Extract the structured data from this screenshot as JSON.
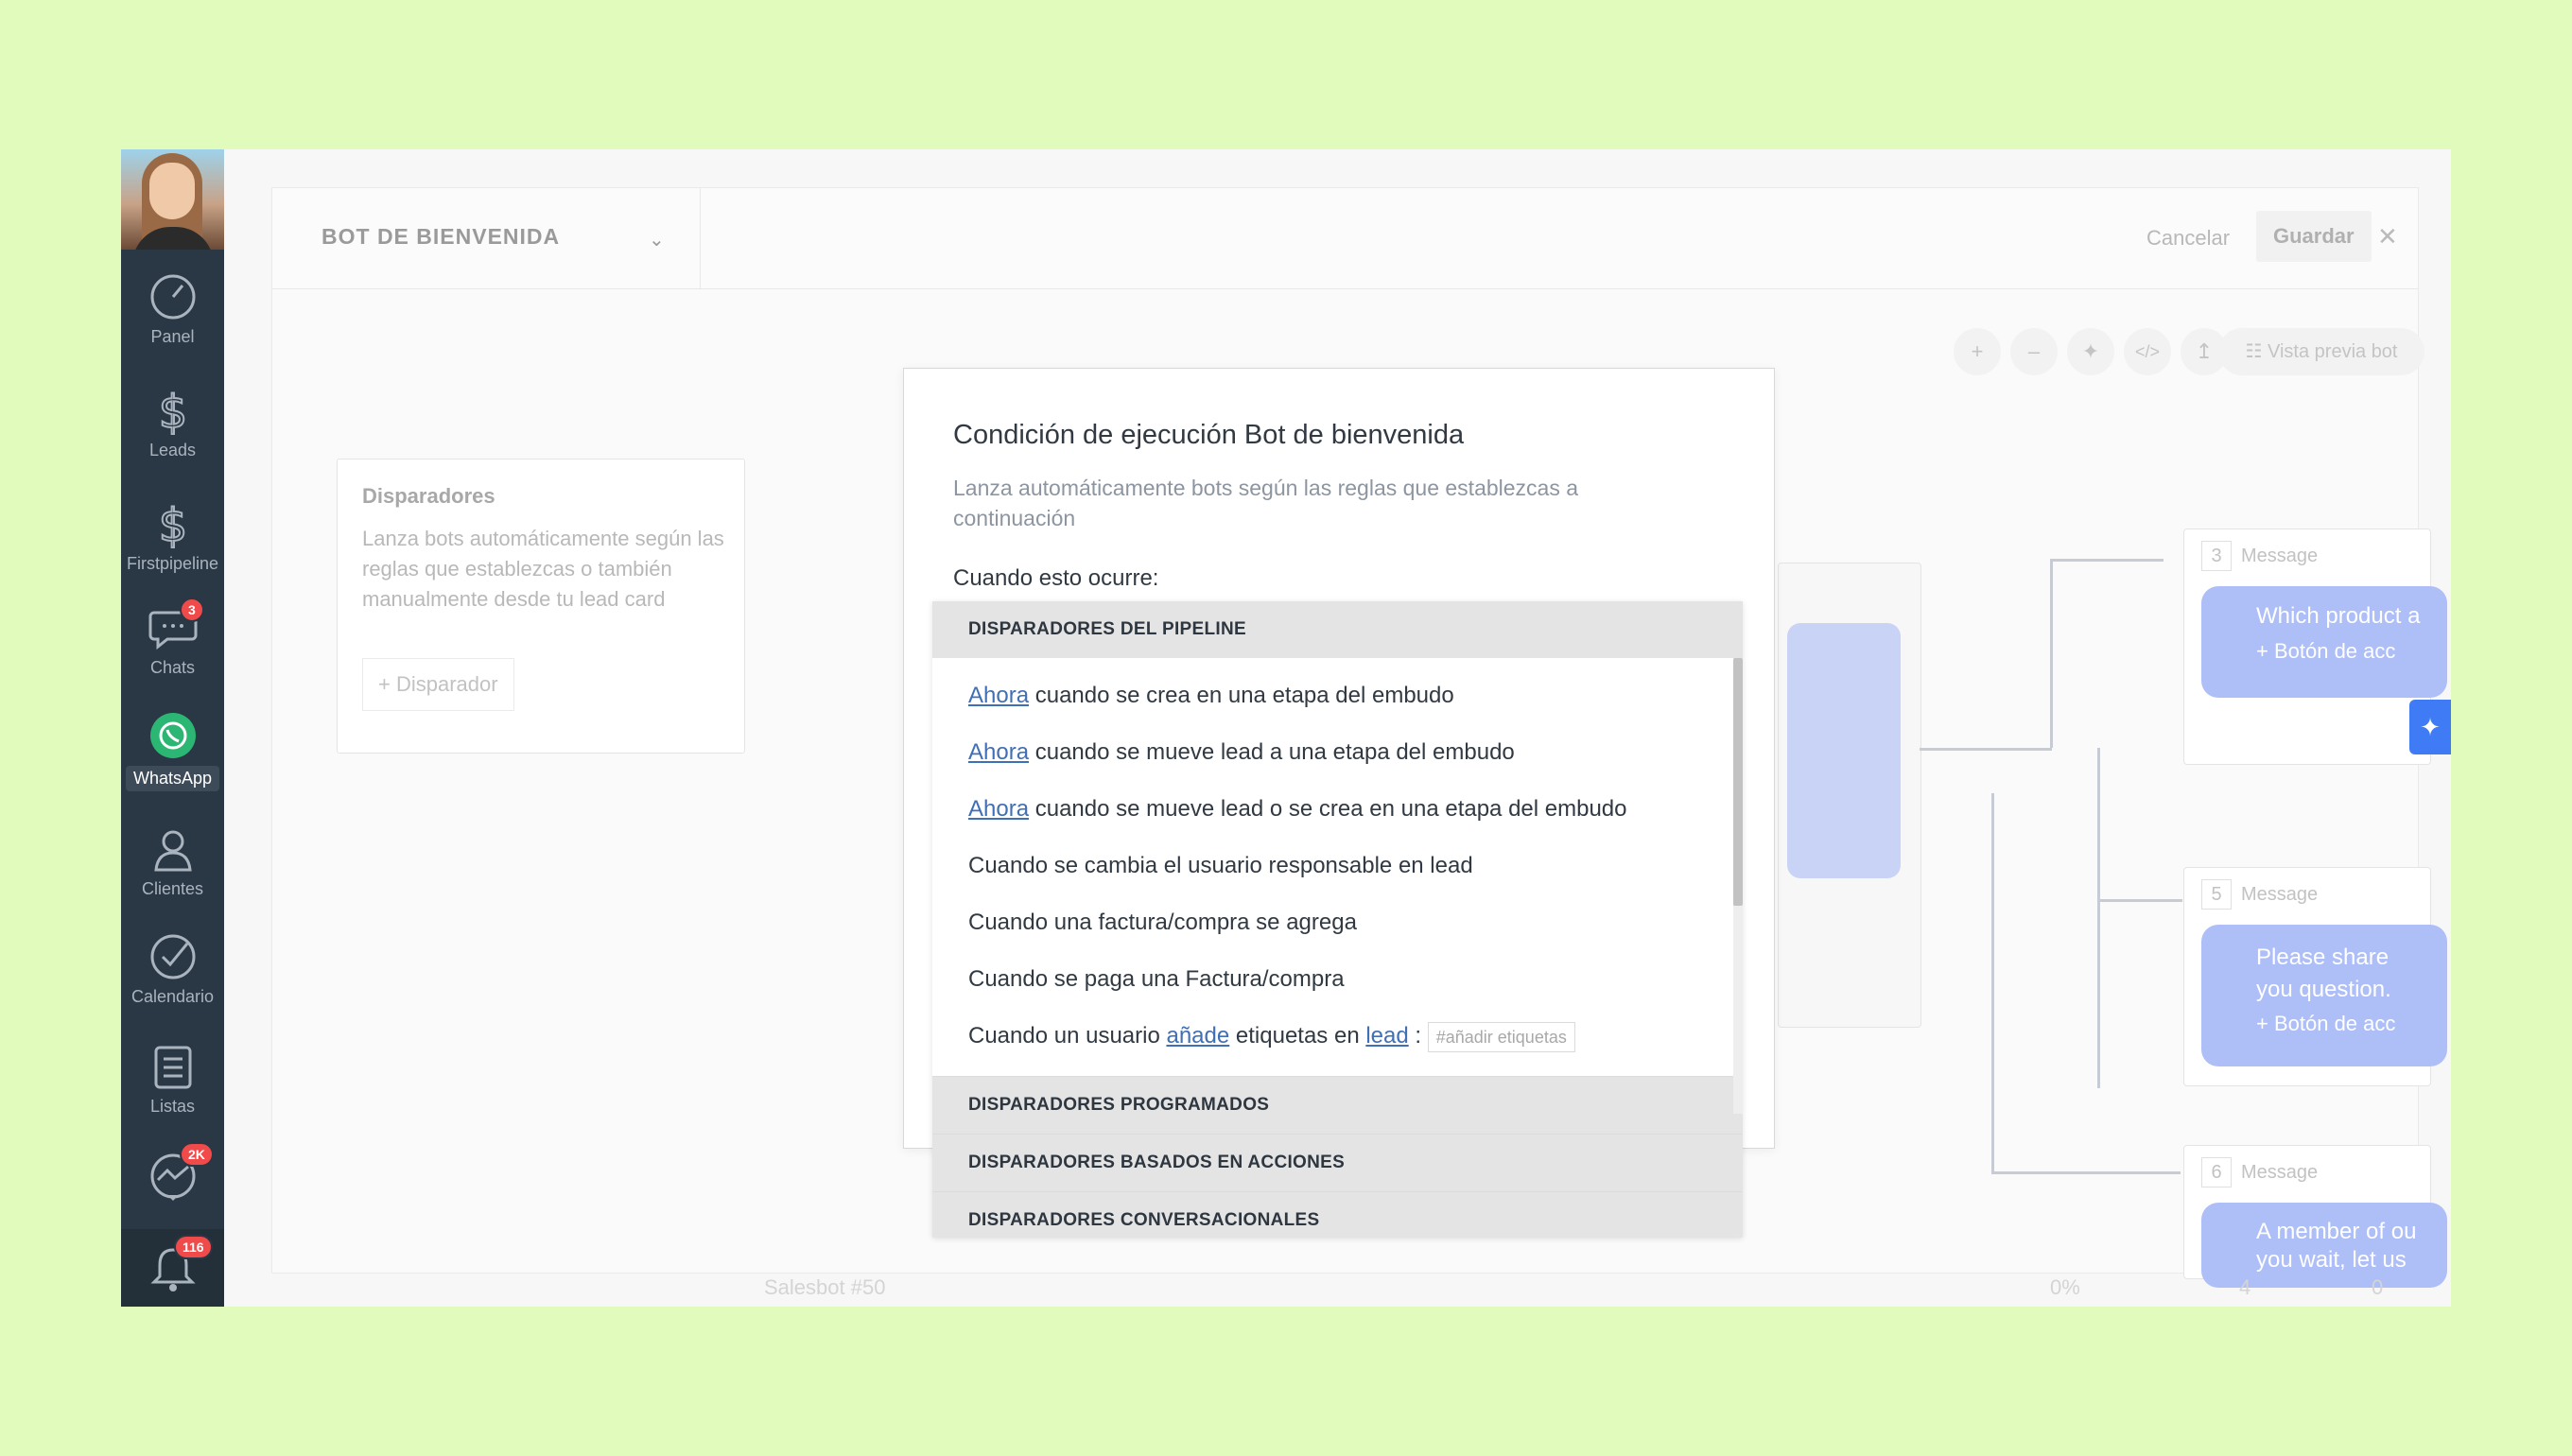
{
  "sidebar": {
    "items": [
      {
        "label": "Panel"
      },
      {
        "label": "Leads"
      },
      {
        "label": "Firstpipeline"
      },
      {
        "label": "Chats",
        "badge": "3"
      },
      {
        "label": "WhatsApp"
      },
      {
        "label": "Clientes"
      },
      {
        "label": "Calendario"
      },
      {
        "label": "Listas"
      },
      {
        "label": "",
        "badge": "2K"
      },
      {
        "label": "",
        "badge": "116"
      }
    ]
  },
  "editor": {
    "bot_name": "BOT DE BIENVENIDA",
    "cancel_label": "Cancelar",
    "save_label": "Guardar",
    "preview_label": "Vista previa bot"
  },
  "triggers_card": {
    "title": "Disparadores",
    "description": "Lanza bots automáticamente según las reglas que establezcas o también manualmente desde tu lead card",
    "add_label": "+ Disparador"
  },
  "canvas": {
    "messages": [
      {
        "num": "3",
        "label": "Message",
        "text": "Which product a",
        "button": "+ Botón de acc"
      },
      {
        "num": "5",
        "label": "Message",
        "text": "Please share you question.",
        "button": "+ Botón de acc"
      },
      {
        "num": "6",
        "label": "Message",
        "text": "A member of ou you wait, let us"
      }
    ],
    "footer": {
      "name": "Salesbot #50",
      "percent": "0%",
      "n1": "4",
      "n2": "0"
    }
  },
  "modal": {
    "title": "Condición de ejecución Bot de bienvenida",
    "subtitle": "Lanza automáticamente bots según las reglas que establezcas a continuación",
    "when_label": "Cuando esto ocurre:",
    "sections": [
      {
        "title": "DISPARADORES DEL PIPELINE"
      },
      {
        "title": "DISPARADORES PROGRAMADOS"
      },
      {
        "title": "DISPARADORES BASADOS EN ACCIONES"
      },
      {
        "title": "DISPARADORES CONVERSACIONALES"
      }
    ],
    "pipeline_items": [
      {
        "link": "Ahora",
        "text": " cuando se crea en una etapa del embudo"
      },
      {
        "link": "Ahora",
        "text": " cuando se mueve lead a una etapa del embudo"
      },
      {
        "link": "Ahora",
        "text": " cuando se mueve lead o se crea en una etapa del embudo"
      },
      {
        "text": "Cuando se cambia el usuario responsable en lead"
      },
      {
        "text": "Cuando una factura/compra se agrega"
      },
      {
        "text": "Cuando se paga una Factura/compra"
      },
      {
        "pre": "Cuando un usuario ",
        "link1": "añade",
        "mid": " etiquetas en ",
        "link2": "lead",
        "post": " :",
        "placeholder": "#añadir etiquetas"
      }
    ]
  }
}
